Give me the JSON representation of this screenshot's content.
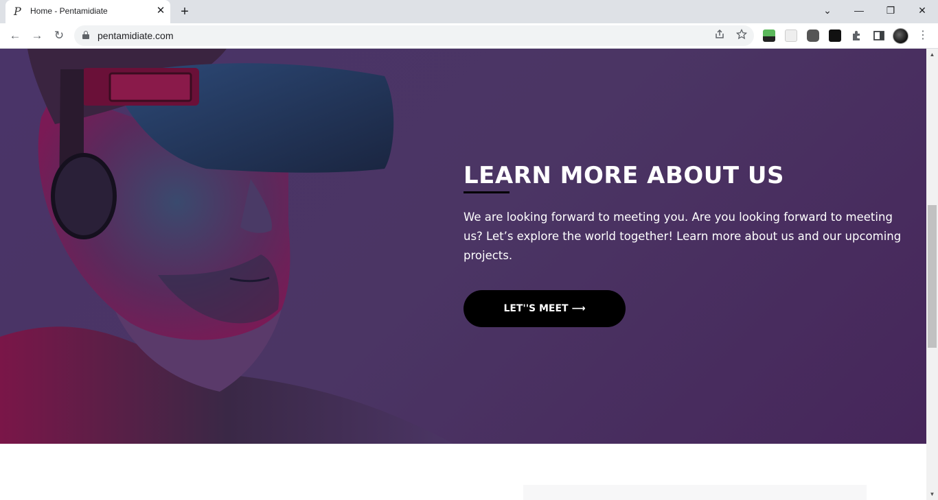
{
  "browser": {
    "tab_title": "Home - Pentamidiate",
    "tab_favicon": "P",
    "new_tab_icon": "+",
    "close_icon": "✕",
    "url": "pentamidiate.com",
    "window_controls": {
      "dropdown": "⌄",
      "minimize": "—",
      "restore": "❐",
      "close": "✕"
    },
    "nav": {
      "back": "←",
      "forward": "→",
      "reload": "↻"
    },
    "omnibox_icons": [
      "share-icon",
      "star-icon"
    ],
    "extensions": [
      "html-extension-icon",
      "blank-extension-icon",
      "camera-extension-icon",
      "a-extension-icon",
      "puzzle-icon",
      "sidepanel-icon"
    ]
  },
  "hero": {
    "title": "LEARN MORE ABOUT US",
    "text": "We are looking forward to meeting you. Are you looking forward to meeting us? Let’s explore the world together! Learn more about us and our upcoming projects.",
    "cta_label": "LET''S MEET ⟶",
    "image": "man-with-vr-headset",
    "colors": {
      "background": "#4a3468",
      "divider": "#000000",
      "button": "#000000",
      "text": "#ffffff"
    }
  }
}
